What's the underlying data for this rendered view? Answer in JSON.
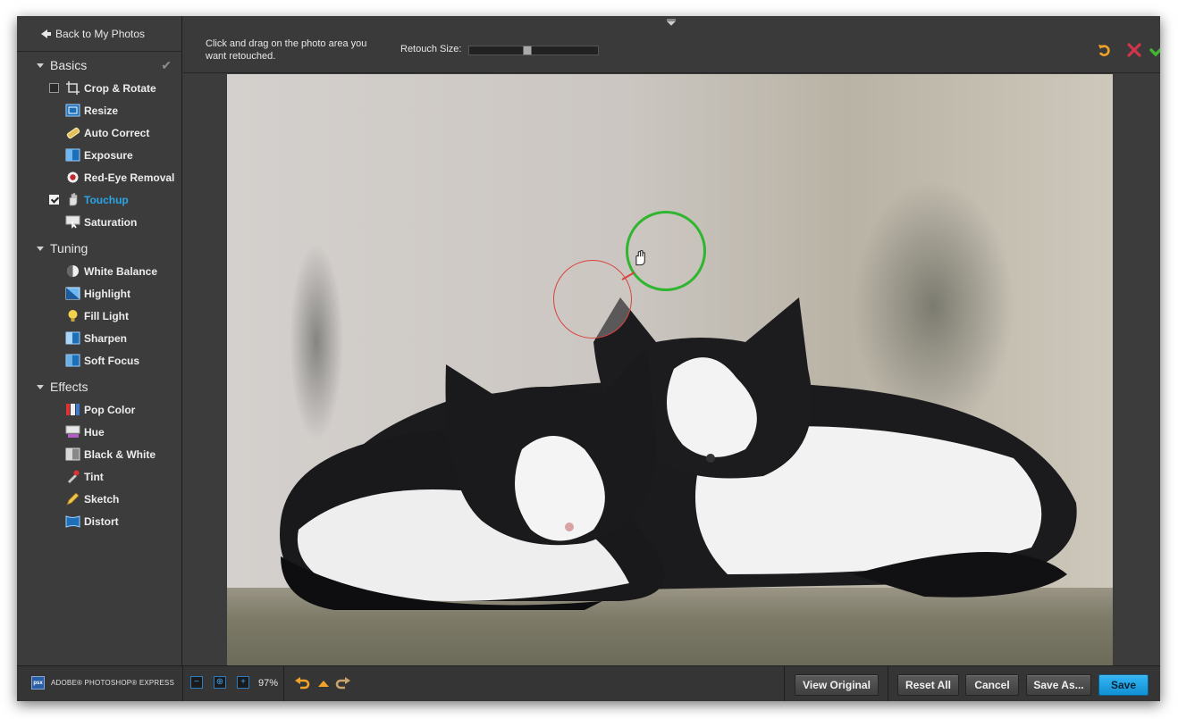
{
  "app": {
    "brand": "ADOBE® PHOTOSHOP® EXPRESS",
    "brand_logo": "psx"
  },
  "sidebar": {
    "back_label": "Back to My Photos",
    "sections": [
      {
        "title": "Basics",
        "tools": [
          {
            "label": "Crop & Rotate",
            "icon": "crop-icon",
            "checkbox": "unchecked"
          },
          {
            "label": "Resize",
            "icon": "resize-icon"
          },
          {
            "label": "Auto Correct",
            "icon": "auto-correct-icon"
          },
          {
            "label": "Exposure",
            "icon": "exposure-icon"
          },
          {
            "label": "Red-Eye Removal",
            "icon": "red-eye-icon"
          },
          {
            "label": "Touchup",
            "icon": "touchup-hand-icon",
            "checkbox": "checked",
            "active": true
          },
          {
            "label": "Saturation",
            "icon": "saturation-icon"
          }
        ]
      },
      {
        "title": "Tuning",
        "tools": [
          {
            "label": "White Balance",
            "icon": "white-balance-icon"
          },
          {
            "label": "Highlight",
            "icon": "highlight-icon"
          },
          {
            "label": "Fill Light",
            "icon": "bulb-icon"
          },
          {
            "label": "Sharpen",
            "icon": "sharpen-icon"
          },
          {
            "label": "Soft Focus",
            "icon": "soft-focus-icon"
          }
        ]
      },
      {
        "title": "Effects",
        "tools": [
          {
            "label": "Pop Color",
            "icon": "pop-color-icon"
          },
          {
            "label": "Hue",
            "icon": "hue-icon"
          },
          {
            "label": "Black & White",
            "icon": "black-white-icon"
          },
          {
            "label": "Tint",
            "icon": "tint-icon"
          },
          {
            "label": "Sketch",
            "icon": "sketch-icon"
          },
          {
            "label": "Distort",
            "icon": "distort-icon"
          }
        ]
      }
    ]
  },
  "toolbar": {
    "hint": "Click and drag on the photo area you want retouched.",
    "retouch_size_label": "Retouch Size:",
    "retouch_size_value": 0.45,
    "reset_icon": "reset-icon",
    "cancel_icon": "cancel-x-icon",
    "accept_icon": "accept-check-icon"
  },
  "bottombar": {
    "zoom_value": "97%",
    "view_original": "View Original",
    "reset_all": "Reset All",
    "cancel": "Cancel",
    "save_as": "Save As...",
    "save": "Save"
  },
  "colors": {
    "accent": "#2aa5e6",
    "save_button": "#1a9fe0",
    "source_ring": "#d9433f",
    "target_ring": "#2fb52f"
  }
}
